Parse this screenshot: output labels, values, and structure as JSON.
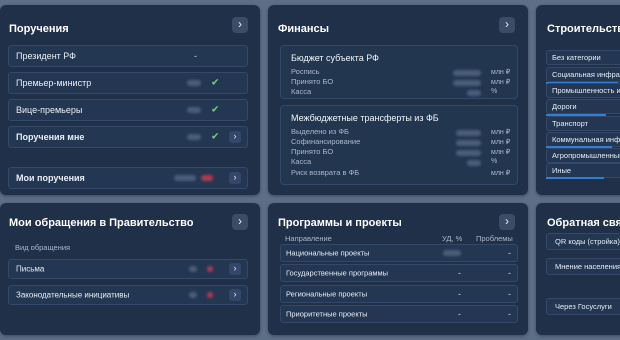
{
  "assignments": {
    "title": "Поручения",
    "rows": [
      {
        "label": "Президент РФ",
        "value": "-"
      },
      {
        "label": "Премьер-министр"
      },
      {
        "label": "Вице-премьеры"
      },
      {
        "label": "Поручения мне"
      }
    ],
    "my_assignments": {
      "label": "Мои поручения"
    }
  },
  "finance": {
    "title": "Финансы",
    "budget": {
      "title": "Бюджет субъекта РФ",
      "lines": [
        {
          "label": "Роспись",
          "unit": "млн ₽"
        },
        {
          "label": "Принято БО",
          "unit": "млн ₽"
        },
        {
          "label": "Касса",
          "unit": "%"
        }
      ]
    },
    "transfers": {
      "title": "Межбюджетные трансферты из ФБ",
      "lines": [
        {
          "label": "Выделено из ФБ",
          "unit": "млн ₽"
        },
        {
          "label": "Софинансирование",
          "unit": "млн ₽"
        },
        {
          "label": "Принято БО",
          "unit": "млн ₽"
        },
        {
          "label": "Касса",
          "unit": "%"
        },
        {
          "label": "Риск возврата в ФБ",
          "unit": "млн ₽"
        }
      ]
    }
  },
  "construction": {
    "title": "Строительство",
    "items": [
      "Без категории",
      "Социальная инфрас",
      "Промышленность и",
      "Дороги",
      "Транспорт",
      "Коммунальная инфр",
      "Агропромышленный",
      "Иные"
    ]
  },
  "appeals": {
    "title": "Мои обращения в Правительство",
    "column_header": "Вид обращения",
    "rows": [
      {
        "label": "Письма"
      },
      {
        "label": "Законодательные инициативы"
      }
    ]
  },
  "programs": {
    "title": "Программы и проекты",
    "headers": {
      "direction": "Направление",
      "share": "УД, %",
      "problems": "Проблемы"
    },
    "rows": [
      {
        "label": "Национальные проекты",
        "share": "",
        "problems": "-"
      },
      {
        "label": "Государственные программы",
        "share": "-",
        "problems": "-"
      },
      {
        "label": "Региональные проекты",
        "share": "-",
        "problems": "-"
      },
      {
        "label": "Приоритетные проекты",
        "share": "-",
        "problems": "-"
      }
    ]
  },
  "feedback": {
    "title": "Обратная связь",
    "items": [
      "QR коды (стройка)",
      "Мнение населения",
      "Через Госуслуги"
    ]
  },
  "icons": {
    "arrow": "chevron-right-icon",
    "check": "check-icon"
  },
  "colors": {
    "background": "#5c6f86",
    "panel": "#1f3048",
    "accent": "#2d7fd8",
    "check": "#6fce72",
    "alert": "#b23a4a"
  }
}
